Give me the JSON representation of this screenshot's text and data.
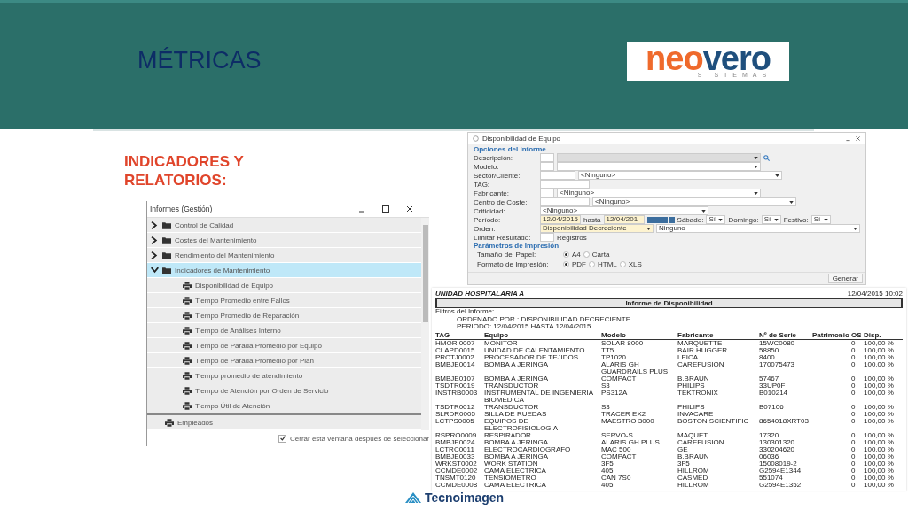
{
  "slide": {
    "title": "MÉTRICAS",
    "logo": {
      "wordmark": [
        {
          "text": "neo",
          "color": "#ef6a2c"
        },
        {
          "text": "vero",
          "color": "#1f4f7d"
        }
      ],
      "tagline": "SISTEMAS"
    },
    "heading": "INDICADORES Y RELATORIOS:",
    "footer_logo": "Tecnoimagen"
  },
  "reports_window": {
    "title": "Informes (Gestión)",
    "tree": [
      {
        "label": "Control de Calidad",
        "kind": "folder",
        "expanded": false,
        "selected": false
      },
      {
        "label": "Costes del Mantenimiento",
        "kind": "folder",
        "expanded": false,
        "selected": false
      },
      {
        "label": "Rendimiento del Mantenimiento",
        "kind": "folder",
        "expanded": false,
        "selected": false
      },
      {
        "label": "Indicadores de Mantenimiento",
        "kind": "folder",
        "expanded": true,
        "selected": true,
        "children": [
          {
            "label": "Disponibilidad de Equipo",
            "kind": "report",
            "selected": false
          },
          {
            "label": "Tiempo Promedio entre Fallos",
            "kind": "report",
            "selected": false
          },
          {
            "label": "Tiempo Promedio de Reparación",
            "kind": "report",
            "selected": false
          },
          {
            "label": "Tiempo de Análises Interno",
            "kind": "report",
            "selected": false
          },
          {
            "label": "Tiempo de Parada Promedio por Equipo",
            "kind": "report",
            "selected": false
          },
          {
            "label": "Tiempo de Parada Promedio por Plan",
            "kind": "report",
            "selected": false
          },
          {
            "label": "Tiempo promedio de atendimiento",
            "kind": "report",
            "selected": false
          },
          {
            "label": "Tiempo de Atención por Orden de Servicio",
            "kind": "report",
            "selected": false
          },
          {
            "label": "Tiempo Útil de Atención",
            "kind": "report",
            "selected": false
          }
        ]
      },
      {
        "label": "Empleados",
        "kind": "report",
        "selected": false
      }
    ],
    "close_after_select": {
      "label": "Cerrar esta ventana después de seleccionar",
      "checked": true
    }
  },
  "form_window": {
    "title": "Disponibilidad de Equipo",
    "options_heading": "Opciones del Informe",
    "fields": [
      {
        "label": "Descripción:",
        "controls": [
          {
            "kind": "code"
          },
          {
            "kind": "select",
            "disabled": true
          },
          {
            "kind": "search"
          }
        ]
      },
      {
        "label": "Modelo:",
        "controls": [
          {
            "kind": "code"
          },
          {
            "kind": "select",
            "disabled": false
          }
        ]
      },
      {
        "label": "Sector/Cliente:",
        "controls": [
          {
            "kind": "text"
          },
          {
            "kind": "select",
            "disabled": false,
            "value": "<Ninguno>"
          }
        ]
      },
      {
        "label": "TAG:",
        "controls": [
          {
            "kind": "wide"
          }
        ]
      },
      {
        "label": "Fabricante:",
        "controls": [
          {
            "kind": "code"
          },
          {
            "kind": "select",
            "disabled": false,
            "value": "<Ninguno>"
          }
        ]
      },
      {
        "label": "Centro de Coste:",
        "controls": [
          {
            "kind": "wide"
          },
          {
            "kind": "select",
            "disabled": false,
            "value": "<Ninguno>"
          }
        ]
      },
      {
        "label": "Criticidad:",
        "controls": [
          {
            "kind": "short",
            "value": "<Ninguno>"
          }
        ]
      },
      {
        "label": "Período:",
        "controls": [
          {
            "kind": "date",
            "value": "12/04/2015"
          },
          {
            "kind": "label",
            "value": "hasta"
          },
          {
            "kind": "date",
            "value": "12/04/201"
          },
          {
            "kind": "tools"
          },
          {
            "kind": "label",
            "value": "Sábado:"
          },
          {
            "kind": "yesno",
            "value": "Sí"
          },
          {
            "kind": "label",
            "value": "Domingo:"
          },
          {
            "kind": "yesno",
            "value": "Sí"
          },
          {
            "kind": "label",
            "value": "Festivo:"
          },
          {
            "kind": "yesno",
            "value": "Sí"
          }
        ]
      },
      {
        "label": "Orden:",
        "controls": [
          {
            "kind": "order",
            "value": "Disponibilidad Decreciente"
          },
          {
            "kind": "select",
            "disabled": false,
            "value": "Ninguno"
          }
        ]
      },
      {
        "label": "Limitar Resultado:",
        "controls": [
          {
            "kind": "code"
          },
          {
            "kind": "label",
            "value": "Registros"
          }
        ]
      }
    ],
    "print_heading": "Parámetros de Impresión",
    "print_options": [
      {
        "label": "Tamaño del Papel:",
        "choices": [
          {
            "label": "A4",
            "selected": true
          },
          {
            "label": "Carta",
            "selected": false
          }
        ]
      },
      {
        "label": "Formato de Impresión:",
        "choices": [
          {
            "label": "PDF",
            "selected": true
          },
          {
            "label": "HTML",
            "selected": false
          },
          {
            "label": "XLS",
            "selected": false
          }
        ]
      }
    ],
    "button": "Generar"
  },
  "report": {
    "unit": "UNIDAD HOSPITALARIA A",
    "timestamp": "12/04/2015 10:02",
    "title": "Informe de Disponibilidad",
    "filters_label": "Filtros del Informe:",
    "filters": [
      "ORDENADO POR : DISPONIBILIDAD DECRECIENTE",
      "PERIODO: 12/04/2015 HASTA 12/04/2015"
    ],
    "columns": [
      "TAG",
      "Equipo",
      "Modelo",
      "Fabricante",
      "Nº de Serie",
      "Patrimonio",
      "OS",
      "Disp."
    ],
    "rows": [
      [
        "HMORI0007",
        "MONITOR",
        "SOLAR 8000",
        "MARQUETTE",
        "15WC0080",
        "",
        "0",
        "100,00 %"
      ],
      [
        "CLAPD0015",
        "UNIDAD DE CALENTAMIENTO",
        "TT5",
        "BAIR HUGGER",
        "58850",
        "",
        "0",
        "100,00 %"
      ],
      [
        "PRCTJ0002",
        "PROCESADOR DE TEJIDOS",
        "TP1020",
        "LEICA",
        "8400",
        "",
        "0",
        "100,00 %"
      ],
      [
        "BMBJE0014",
        "BOMBA A JERINGA",
        "ALARIS GH GUARDRAILS PLUS",
        "CAREFUSION",
        "170075473",
        "",
        "0",
        "100,00 %"
      ],
      [
        "BMBJE0107",
        "BOMBA A JERINGA",
        "COMPACT",
        "B.BRAUN",
        "57467",
        "",
        "0",
        "100,00 %"
      ],
      [
        "TSDTR0019",
        "TRANSDUCTOR",
        "S3",
        "PHILIPS",
        "33UP0F",
        "",
        "0",
        "100,00 %"
      ],
      [
        "INSTRB0003",
        "INSTRUMENTAL DE INGENIERIA BIOMEDICA",
        "PS312A",
        "TEKTRONIX",
        "B010214",
        "",
        "0",
        "100,00 %"
      ],
      [
        "TSDTR0012",
        "TRANSDUCTOR",
        "S3",
        "PHILIPS",
        "B07106",
        "",
        "0",
        "100,00 %"
      ],
      [
        "SLRDR0005",
        "SILLA DE RUEDAS",
        "TRACER EX2",
        "INVACARE",
        "",
        "",
        "0",
        "100,00 %"
      ],
      [
        "LCTPS0005",
        "EQUIPOS DE ELECTROFISIOLOGIA",
        "MAESTRO 3000",
        "BOSTON SCIENTIFIC",
        "8654018XRT03",
        "",
        "0",
        "100,00 %"
      ],
      [
        "RSPRO0009",
        "RESPIRADOR",
        "SERVO-S",
        "MAQUET",
        "17320",
        "",
        "0",
        "100,00 %"
      ],
      [
        "BMBJE0024",
        "BOMBA A JERINGA",
        "ALARIS GH PLUS",
        "CAREFUSION",
        "130301320",
        "",
        "0",
        "100,00 %"
      ],
      [
        "LCTRC0011",
        "ELECTROCARDIOGRAFO",
        "MAC 500",
        "GE",
        "330204620",
        "",
        "0",
        "100,00 %"
      ],
      [
        "BMBJE0033",
        "BOMBA A JERINGA",
        "COMPACT",
        "B.BRAUN",
        "06036",
        "",
        "0",
        "100,00 %"
      ],
      [
        "WRKST0002",
        "WORK STATION",
        "3F5",
        "3F5",
        "15008019-2",
        "",
        "0",
        "100,00 %"
      ],
      [
        "CCMDE0002",
        "CAMA ELECTRICA",
        "405",
        "HILLROM",
        "G2594E1344",
        "",
        "0",
        "100,00 %"
      ],
      [
        "TNSMT0120",
        "TENSIOMETRO",
        "CAN 7S0",
        "CASMED",
        "551074",
        "",
        "0",
        "100,00 %"
      ],
      [
        "CCMDE0008",
        "CAMA ELECTRICA",
        "405",
        "HILLROM",
        "G2594E1352",
        "",
        "0",
        "100,00 %"
      ]
    ]
  }
}
